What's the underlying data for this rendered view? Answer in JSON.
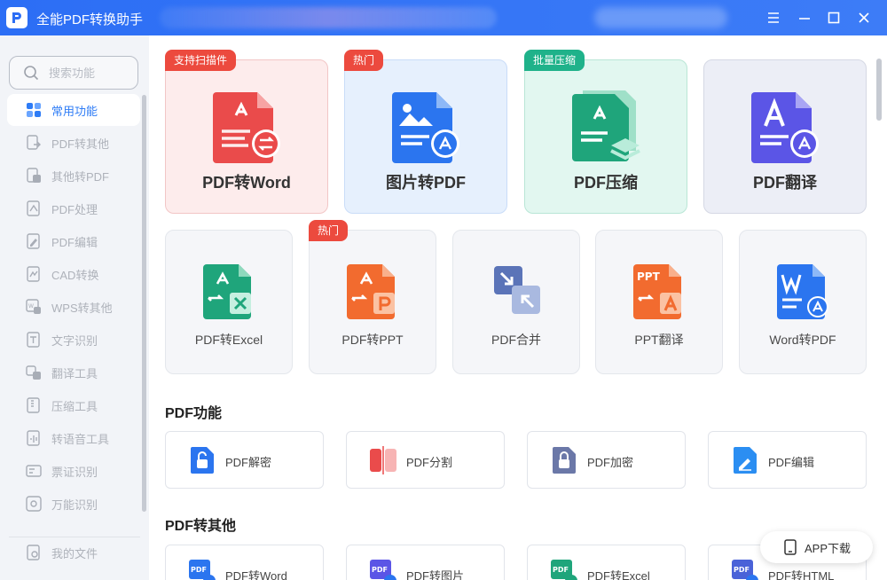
{
  "window": {
    "title": "全能PDF转换助手"
  },
  "sidebar": {
    "search_placeholder": "搜索功能",
    "items": [
      {
        "label": "常用功能",
        "icon": "common-functions-icon"
      },
      {
        "label": "PDF转其他",
        "icon": "pdf-to-other-icon"
      },
      {
        "label": "其他转PDF",
        "icon": "other-to-pdf-icon"
      },
      {
        "label": "PDF处理",
        "icon": "pdf-process-icon"
      },
      {
        "label": "PDF编辑",
        "icon": "pdf-edit-icon"
      },
      {
        "label": "CAD转换",
        "icon": "cad-convert-icon"
      },
      {
        "label": "WPS转其他",
        "icon": "wps-convert-icon"
      },
      {
        "label": "文字识别",
        "icon": "text-recognition-icon"
      },
      {
        "label": "翻译工具",
        "icon": "translate-icon"
      },
      {
        "label": "压缩工具",
        "icon": "compress-icon"
      },
      {
        "label": "转语音工具",
        "icon": "speech-icon"
      },
      {
        "label": "票证识别",
        "icon": "ticket-recognition-icon"
      },
      {
        "label": "万能识别",
        "icon": "universal-recognition-icon"
      }
    ],
    "my_files": "我的文件"
  },
  "featured": [
    {
      "label": "PDF转Word",
      "badge": "支持扫描件",
      "badge_color": "#ec4a3e",
      "bg": "#fdecec",
      "accent": "#ea4b4b"
    },
    {
      "label": "图片转PDF",
      "badge": "热门",
      "badge_color": "#ec4a3e",
      "bg": "#e6f0fd",
      "accent": "#2b75ef"
    },
    {
      "label": "PDF压缩",
      "badge": "批量压缩",
      "badge_color": "#1fb28a",
      "bg": "#e2f7f0",
      "accent": "#1fa57b"
    },
    {
      "label": "PDF翻译",
      "badge": "",
      "badge_color": "",
      "bg": "#eceef6",
      "accent": "#5b55e6"
    }
  ],
  "tools": [
    {
      "label": "PDF转Excel",
      "badge": ""
    },
    {
      "label": "PDF转PPT",
      "badge": "热门"
    },
    {
      "label": "PDF合并",
      "badge": ""
    },
    {
      "label": "PPT翻译",
      "badge": ""
    },
    {
      "label": "Word转PDF",
      "badge": ""
    }
  ],
  "pdf_functions": {
    "title": "PDF功能",
    "items": [
      {
        "label": "PDF解密",
        "icon": "unlock-icon"
      },
      {
        "label": "PDF分割",
        "icon": "split-icon"
      },
      {
        "label": "PDF加密",
        "icon": "lock-icon"
      },
      {
        "label": "PDF编辑",
        "icon": "edit-icon"
      }
    ]
  },
  "pdf_to_other": {
    "title": "PDF转其他",
    "items": [
      {
        "label": "PDF转Word",
        "icon_text": "PDF"
      },
      {
        "label": "PDF转图片",
        "icon_text": "PDF"
      },
      {
        "label": "PDF转Excel",
        "icon_text": "PDF"
      },
      {
        "label": "PDF转HTML",
        "icon_text": "PDF"
      }
    ]
  },
  "app_download": "APP下载"
}
